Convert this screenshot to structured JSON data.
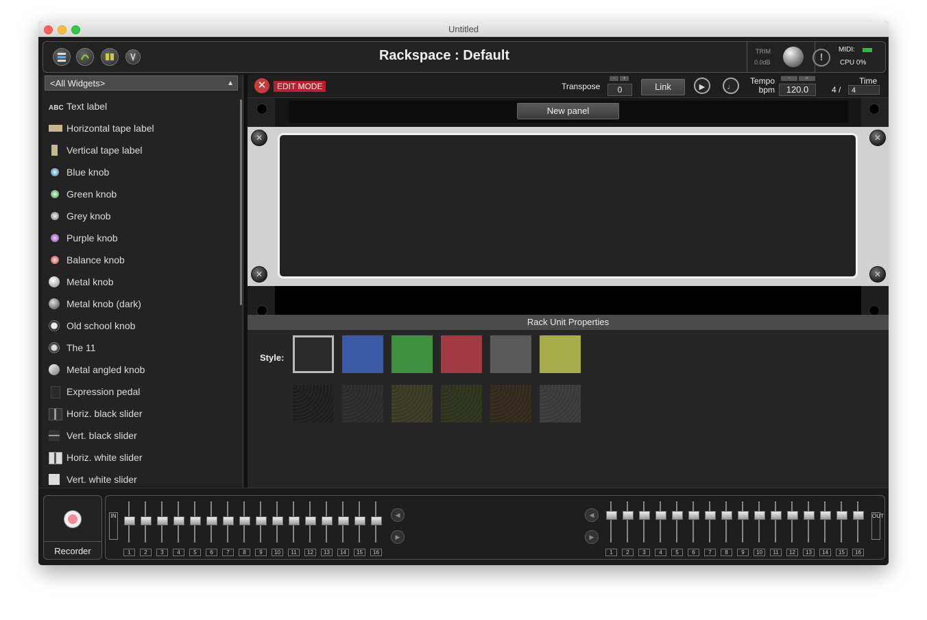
{
  "window": {
    "title": "Untitled"
  },
  "header": {
    "rackspace_title": "Rackspace : Default",
    "trim_label": "TRIM",
    "trim_value": "0.0dB",
    "warning_glyph": "!",
    "midi_label": "MIDI:",
    "cpu_label": "CPU  0%"
  },
  "left": {
    "dropdown_value": "<All Widgets>",
    "widgets": [
      {
        "label": "Text label",
        "icon": "abc-text-icon"
      },
      {
        "label": "Horizontal tape label",
        "icon": "tape-label-icon"
      },
      {
        "label": "Vertical tape label",
        "icon": "vertical-tape-icon"
      },
      {
        "label": "Blue knob",
        "icon": "blue-knob-icon"
      },
      {
        "label": "Green knob",
        "icon": "green-knob-icon"
      },
      {
        "label": "Grey knob",
        "icon": "grey-knob-icon"
      },
      {
        "label": "Purple knob",
        "icon": "purple-knob-icon"
      },
      {
        "label": "Balance knob",
        "icon": "balance-knob-icon"
      },
      {
        "label": "Metal knob",
        "icon": "metal-knob-icon"
      },
      {
        "label": "Metal knob (dark)",
        "icon": "metal-knob-dark-icon"
      },
      {
        "label": "Old school knob",
        "icon": "old-school-knob-icon"
      },
      {
        "label": "The 11",
        "icon": "the-11-knob-icon"
      },
      {
        "label": "Metal angled knob",
        "icon": "metal-angled-knob-icon"
      },
      {
        "label": "Expression pedal",
        "icon": "expression-pedal-icon"
      },
      {
        "label": "Horiz. black slider",
        "icon": "horiz-black-slider-icon"
      },
      {
        "label": "Vert. black slider",
        "icon": "vert-black-slider-icon"
      },
      {
        "label": "Horiz. white slider",
        "icon": "horiz-white-slider-icon"
      },
      {
        "label": "Vert. white slider",
        "icon": "vert-white-slider-icon"
      }
    ]
  },
  "toolbar": {
    "edit_mode": "EDIT MODE",
    "transpose_label": "Transpose",
    "transpose_value": "0",
    "minus": "-",
    "plus": "+",
    "link": "Link",
    "tempo_label": "Tempo",
    "bpm_label": "bpm",
    "tempo_value": "120.0",
    "time_label": "Time",
    "time_numerator": "4 /",
    "time_denominator": "4"
  },
  "rack": {
    "new_panel": "New panel"
  },
  "properties": {
    "header": "Rack Unit Properties",
    "style_label": "Style:",
    "swatch_colors": [
      "#2a2a2a",
      "#3a5aa8",
      "#3f8f3f",
      "#a23a44",
      "#5a5a5a",
      "#a4ad48"
    ],
    "texture_colors": [
      "#1e1e1e",
      "#2c2c2c",
      "#3a3a24",
      "#2e331e",
      "#332a1e",
      "#3a3a3a"
    ]
  },
  "mixer": {
    "recorder_label": "Recorder",
    "in_label": "IN",
    "out_label": "OUT",
    "channels": [
      "1",
      "2",
      "3",
      "4",
      "5",
      "6",
      "7",
      "8",
      "9",
      "10",
      "11",
      "12",
      "13",
      "14",
      "15",
      "16"
    ]
  }
}
